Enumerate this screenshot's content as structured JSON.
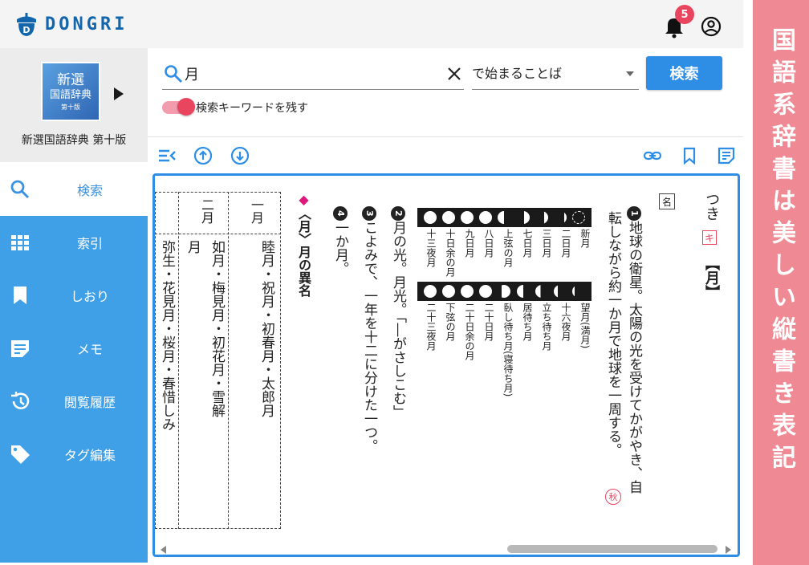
{
  "app": {
    "logo_text": "DONGRI",
    "notification_count": "5"
  },
  "book": {
    "cover_line1": "新選",
    "cover_line2": "国語辞典",
    "cover_line3": "第十版",
    "name": "新選国語辞典 第十版"
  },
  "nav": {
    "items": [
      {
        "label": "検索",
        "icon": "search-icon"
      },
      {
        "label": "索引",
        "icon": "grid-icon"
      },
      {
        "label": "しおり",
        "icon": "bookmark-icon"
      },
      {
        "label": "メモ",
        "icon": "memo-icon"
      },
      {
        "label": "閲覧履歴",
        "icon": "history-icon"
      },
      {
        "label": "タグ編集",
        "icon": "tag-icon"
      }
    ]
  },
  "search": {
    "value": "月",
    "mode": "で始まることば",
    "button_label": "検索",
    "keep_keyword_label": "検索キーワードを残す",
    "keep_keyword_on": true
  },
  "entry": {
    "reading": "つき",
    "kanji_badge": "キ",
    "headword": "【月】",
    "pos": "名",
    "sense1_text": "地球の衛星。太陽の光を受けてかがやき、自転しながら約一か月で地球を一周する。",
    "sense1_line1": "地球の衛星。太陽の光を受けてかがやき、自",
    "sense1_line2": "転しながら約一か月で地球を一周する。",
    "season_badge": "秋",
    "sense2": "月の光。月光。「―がさしこむ」",
    "sense3": "こよみで、一年を十二に分けた一つ。",
    "sense4": "一か月。",
    "section_title": "〈月〉月の異名",
    "moon_row1": [
      "新月",
      "二日月",
      "三日月",
      "七日月",
      "上弦の月",
      "八日月",
      "九日月",
      "十日余の月",
      "十三夜月"
    ],
    "moon_row2": [
      "望月(満月)",
      "十六夜月",
      "立ち待ち月",
      "居待ち月",
      "臥し待ち月(寝待ち月)",
      "二十日月",
      "二十日余の月",
      "下弦の月",
      "二十三夜月"
    ],
    "months": [
      {
        "name": "一月",
        "text1": "睦月・祝月・初春月・太郎月"
      },
      {
        "name": "二月",
        "text1": "如月・梅見月・初花月・雪解",
        "text2": "月"
      },
      {
        "name": "",
        "text1": "弥生・花見月・桜月・春惜しみ"
      }
    ]
  },
  "banner": {
    "text": "国語系辞書は美しい縦書き表記"
  },
  "colors": {
    "accent": "#2e8ee6",
    "nav_bg": "#3fa0e8",
    "banner_bg": "#ef8a94",
    "brand": "#1466ac",
    "badge": "#e9455f"
  }
}
